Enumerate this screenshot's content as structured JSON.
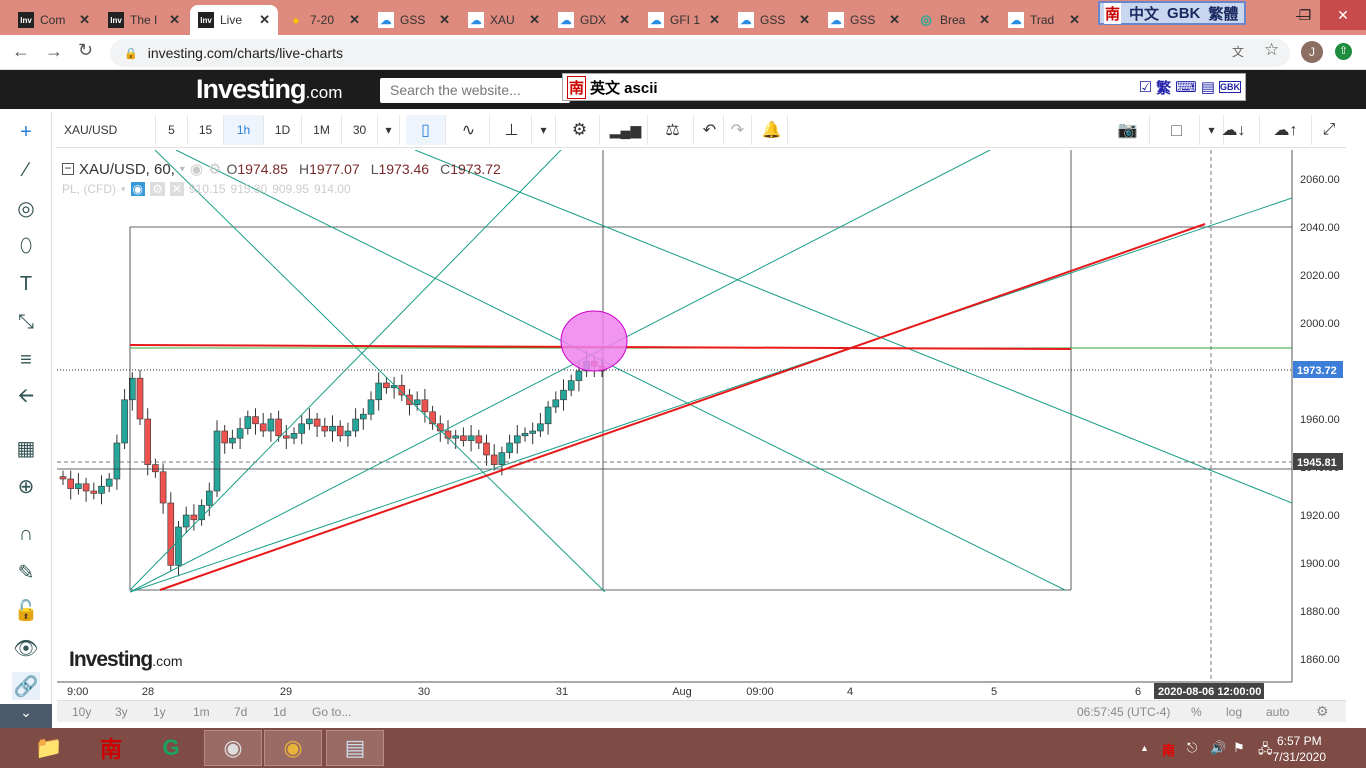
{
  "browser": {
    "tabs": [
      {
        "label": "Com",
        "icon": "investing"
      },
      {
        "label": "The I",
        "icon": "investing"
      },
      {
        "label": "Live",
        "icon": "investing",
        "active": true
      },
      {
        "label": "7-20",
        "icon": "gem"
      },
      {
        "label": "GSS",
        "icon": "cloud"
      },
      {
        "label": "XAU",
        "icon": "cloud"
      },
      {
        "label": "GDX",
        "icon": "cloud"
      },
      {
        "label": "GFI 1",
        "icon": "cloud"
      },
      {
        "label": "GSS",
        "icon": "cloud"
      },
      {
        "label": "GSS",
        "icon": "cloud"
      },
      {
        "label": "Brea",
        "icon": "circle"
      },
      {
        "label": "Trad",
        "icon": "cloud"
      }
    ],
    "url": "investing.com/charts/live-charts",
    "profile_initial": "J",
    "ime_bar": {
      "logo": "南",
      "lang": "中文",
      "encoding": "GBK",
      "script": "繁體"
    },
    "ime_input": {
      "logo": "南",
      "text": "英文 ascii",
      "right": "繁",
      "gbk": "GBK"
    }
  },
  "site": {
    "logo_main": "Investing",
    "logo_suffix": ".com",
    "search_placeholder": "Search the website..."
  },
  "toolbar": {
    "symbol": "XAU/USD",
    "intervals": [
      "5",
      "15",
      "1h",
      "1D",
      "1M",
      "30"
    ],
    "selected_interval": "1h"
  },
  "legend": {
    "title": "XAU/USD, 60,",
    "o_label": "O",
    "o": "1974.85",
    "h_label": "H",
    "h": "1977.07",
    "l_label": "L",
    "l": "1973.46",
    "c_label": "C",
    "c": "1973.72",
    "sub_title": "PL, (CFD)",
    "sub_values": [
      "910.15",
      "915.30",
      "909.95",
      "914.00"
    ]
  },
  "watermark": {
    "main": "Investing",
    "suffix": ".com"
  },
  "chart_data": {
    "type": "candlestick",
    "symbol": "XAU/USD",
    "interval": "60",
    "ylim": [
      1850,
      2070
    ],
    "y_ticks": [
      "2060.00",
      "2040.00",
      "2020.00",
      "2000.00",
      "1980.00",
      "1960.00",
      "1940.00",
      "1920.00",
      "1900.00",
      "1880.00",
      "1860.00"
    ],
    "y_tick_values": [
      2060,
      2040,
      2020,
      2000,
      1980,
      1960,
      1940,
      1920,
      1900,
      1880,
      1860
    ],
    "x_ticks": [
      "9:00",
      "28",
      "29",
      "30",
      "31",
      "Aug",
      "09:00",
      "4",
      "5",
      "6"
    ],
    "current_price": "1973.72",
    "crosshair_price": "1945.81",
    "crosshair_time": "2020-08-06 12:00:00",
    "closes": [
      1935,
      1931,
      1933,
      1930,
      1929,
      1932,
      1935,
      1950,
      1968,
      1977,
      1960,
      1941,
      1938,
      1925,
      1899,
      1915,
      1920,
      1918,
      1924,
      1930,
      1955,
      1950,
      1952,
      1956,
      1961,
      1958,
      1955,
      1960,
      1953,
      1952,
      1954,
      1958,
      1960,
      1957,
      1955,
      1957,
      1953,
      1955,
      1960,
      1962,
      1968,
      1975,
      1973,
      1974,
      1970,
      1966,
      1968,
      1963,
      1958,
      1955,
      1952,
      1953,
      1951,
      1953,
      1950,
      1945,
      1941,
      1946,
      1950,
      1953,
      1954,
      1955,
      1958,
      1965,
      1968,
      1972,
      1976,
      1980,
      1984,
      1982,
      1980
    ],
    "colors": {
      "up": "#26a69a",
      "down": "#ef5350",
      "drawing": "#1a9e88",
      "trend": "#e8191a",
      "highlight": "#ee82ee"
    }
  },
  "bottom": {
    "ranges": [
      "10y",
      "3y",
      "1y",
      "1m",
      "7d",
      "1d",
      "Go to..."
    ],
    "time": "06:57:45 (UTC-4)",
    "pct": "%",
    "log": "log",
    "auto": "auto"
  },
  "taskbar": {
    "time": "6:57 PM",
    "date": "7/31/2020"
  }
}
